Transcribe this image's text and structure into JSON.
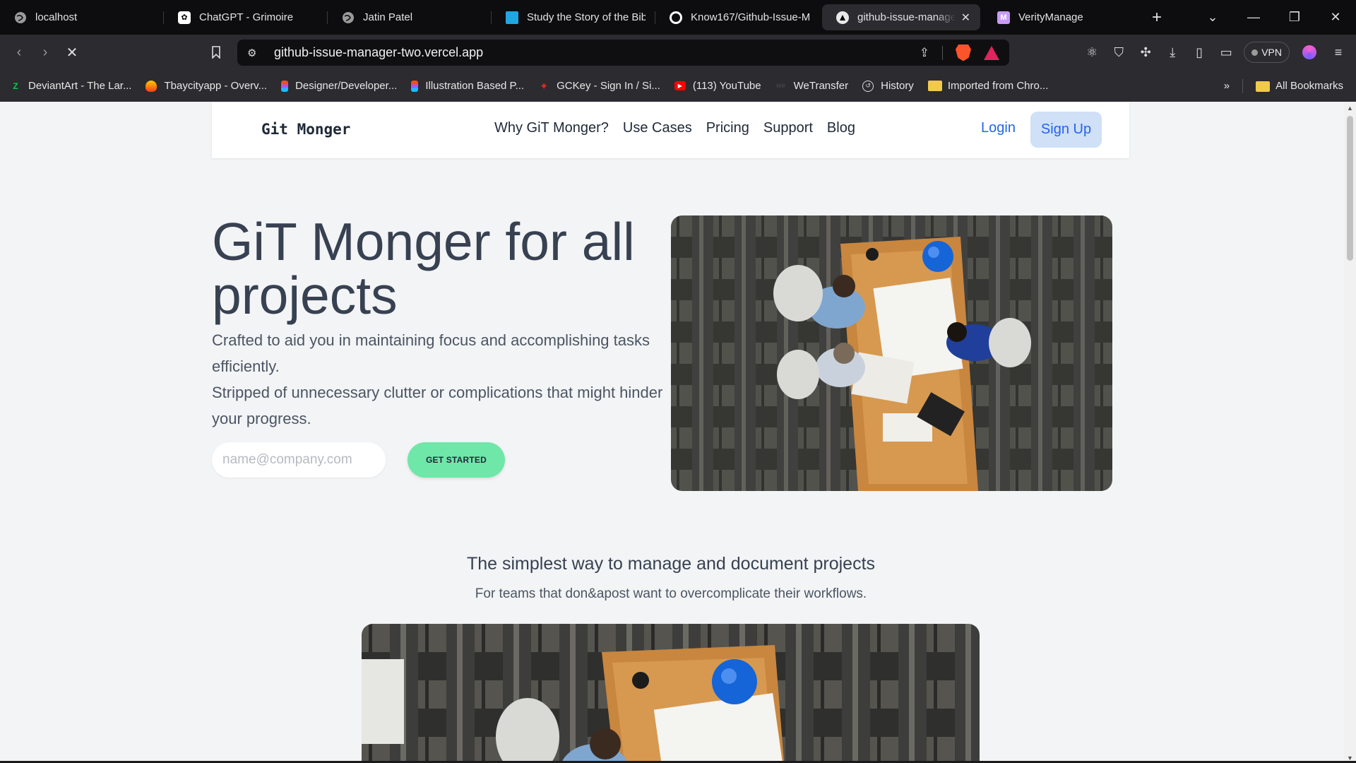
{
  "browser": {
    "tabs": [
      {
        "title": "localhost",
        "icon": "globe-icon"
      },
      {
        "title": "ChatGPT - Grimoire",
        "icon": "openai-icon"
      },
      {
        "title": "Jatin Patel",
        "icon": "globe-icon"
      },
      {
        "title": "Study the Story of the Bib",
        "icon": "book-icon"
      },
      {
        "title": "Know167/Github-Issue-M",
        "icon": "github-icon"
      },
      {
        "title": "github-issue-manage",
        "icon": "vercel-icon",
        "active": true
      },
      {
        "title": "VerityManage",
        "icon": "vm-icon"
      }
    ],
    "new_tab": "+",
    "url": "github-issue-manager-two.vercel.app",
    "vpn_label": "VPN",
    "bookmarks": [
      {
        "label": "DeviantArt - The Lar...",
        "color": "#05cc47"
      },
      {
        "label": "Tbaycityapp - Overv...",
        "color": "#ff6b1a"
      },
      {
        "label": "Designer/Developer...",
        "color": "#f24e1e"
      },
      {
        "label": "Illustration Based P...",
        "color": "#a259ff"
      },
      {
        "label": "GCKey - Sign In / Si...",
        "color": "#d52b1e"
      },
      {
        "label": "(113) YouTube",
        "color": "#ff0000"
      },
      {
        "label": "WeTransfer",
        "color": "#333333"
      },
      {
        "label": "History",
        "color": "#cccccc"
      },
      {
        "label": "Imported from Chro...",
        "color": "#f2c94c"
      }
    ],
    "all_bookmarks": "All Bookmarks"
  },
  "page": {
    "logo": "Git Monger",
    "nav": [
      "Why GiT Monger?",
      "Use Cases",
      "Pricing",
      "Support",
      "Blog"
    ],
    "login": "Login",
    "signup": "Sign Up",
    "hero": {
      "title": "GiT Monger for all projects",
      "sub1": "Crafted to aid you in maintaining focus and accomplishing tasks efficiently.",
      "sub2": "Stripped of unnecessary clutter or complications that might hinder your progress.",
      "email_placeholder": "name@company.com",
      "cta": "GET STARTED"
    },
    "section": {
      "title": "The simplest way to manage and document projects",
      "sub": "For teams that don&apost want to overcomplicate their workflows."
    },
    "colors": {
      "accent": "#2563eb",
      "cta": "#6ee7a8",
      "signup_bg": "#cfe0f7"
    }
  }
}
